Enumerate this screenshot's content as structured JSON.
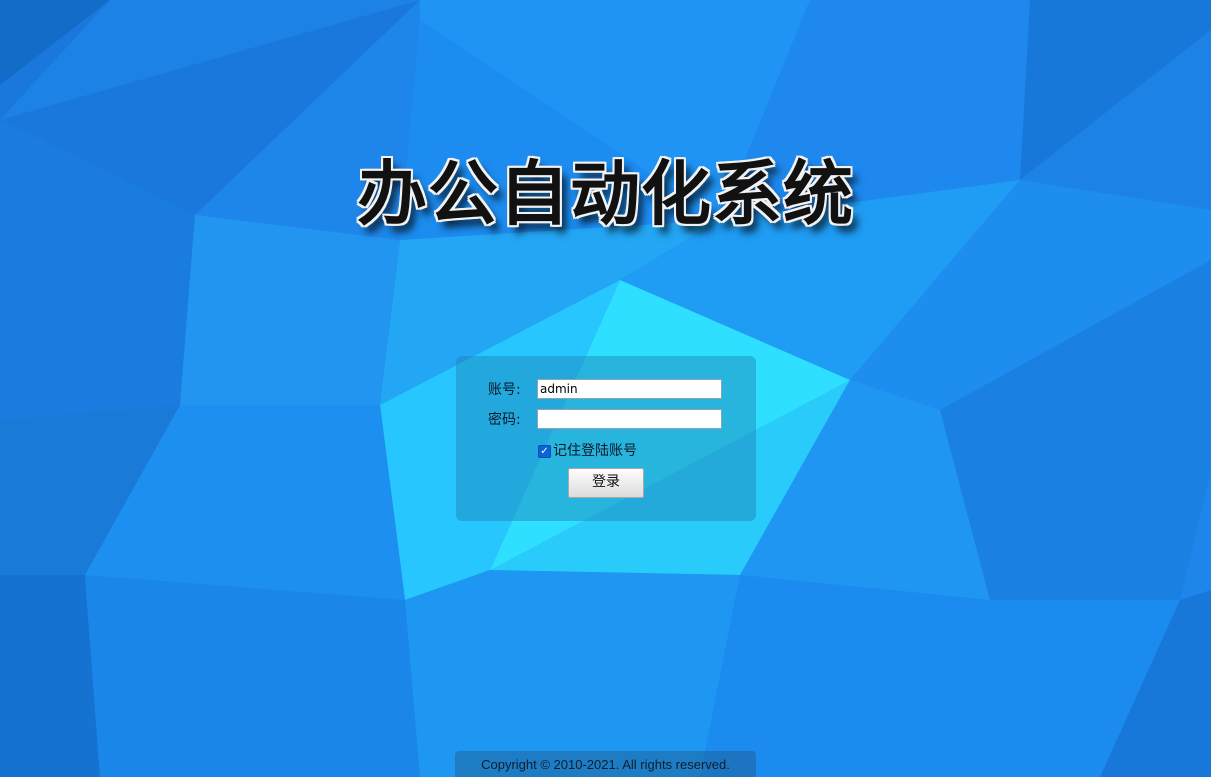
{
  "header": {
    "title": "办公自动化系统"
  },
  "login": {
    "account_label": "账号:",
    "account_value": "admin",
    "password_label": "密码:",
    "password_value": "",
    "remember_label": "记住登陆账号",
    "remember_checked": true,
    "submit_label": "登录"
  },
  "footer": {
    "copyright": "Copyright © 2010-2021. All rights reserved."
  },
  "colors": {
    "background": "#1e86ea",
    "accent_cyan": "#33f0ff",
    "checkbox": "#0a64d6"
  }
}
